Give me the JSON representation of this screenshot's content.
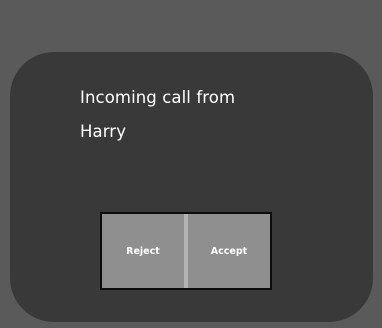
{
  "dialog": {
    "message_line1": "Incoming call from",
    "message_line2": "Harry",
    "reject_label": "Reject",
    "accept_label": "Accept"
  },
  "colors": {
    "background": "#5a5a5a",
    "dialog": "#393939",
    "button": "#8f8f8f",
    "button_divider": "#b3b3b3",
    "button_border": "#0c0c0c",
    "text": "#ffffff"
  }
}
